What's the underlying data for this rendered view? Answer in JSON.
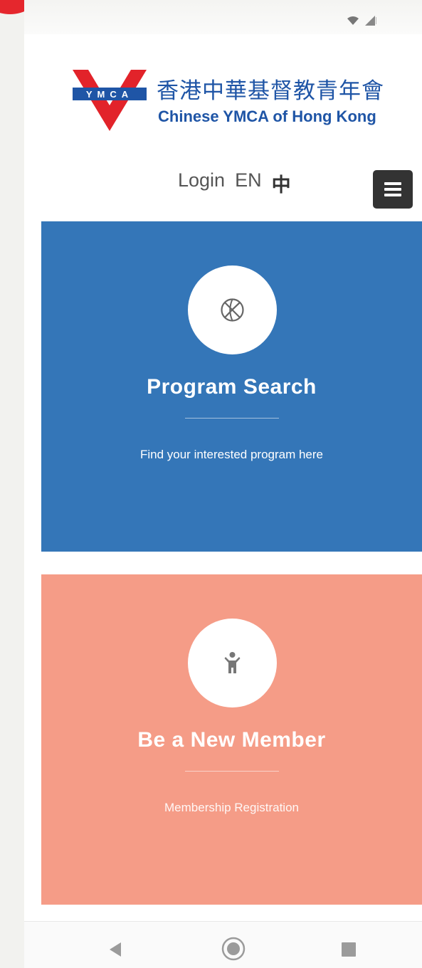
{
  "brand": {
    "logo_letters": "YMCA",
    "name_zh": "香港中華基督教青年會",
    "name_en": "Chinese YMCA of Hong Kong"
  },
  "nav": {
    "login": "Login",
    "lang_en": "EN",
    "lang_zh": "中",
    "menu_icon": "hamburger-menu-icon"
  },
  "cards": [
    {
      "icon": "basketball-icon",
      "title": "Program Search",
      "subtitle": "Find your interested program here",
      "color": "#3476b8"
    },
    {
      "icon": "person-icon",
      "title": "Be a New Member",
      "subtitle": "Membership Registration",
      "color": "#f59c87"
    }
  ],
  "status_bar": {
    "icons": [
      "wifi-icon",
      "signal-icon"
    ]
  },
  "system_nav": {
    "icons": [
      "back-icon",
      "home-icon",
      "recents-icon"
    ]
  }
}
